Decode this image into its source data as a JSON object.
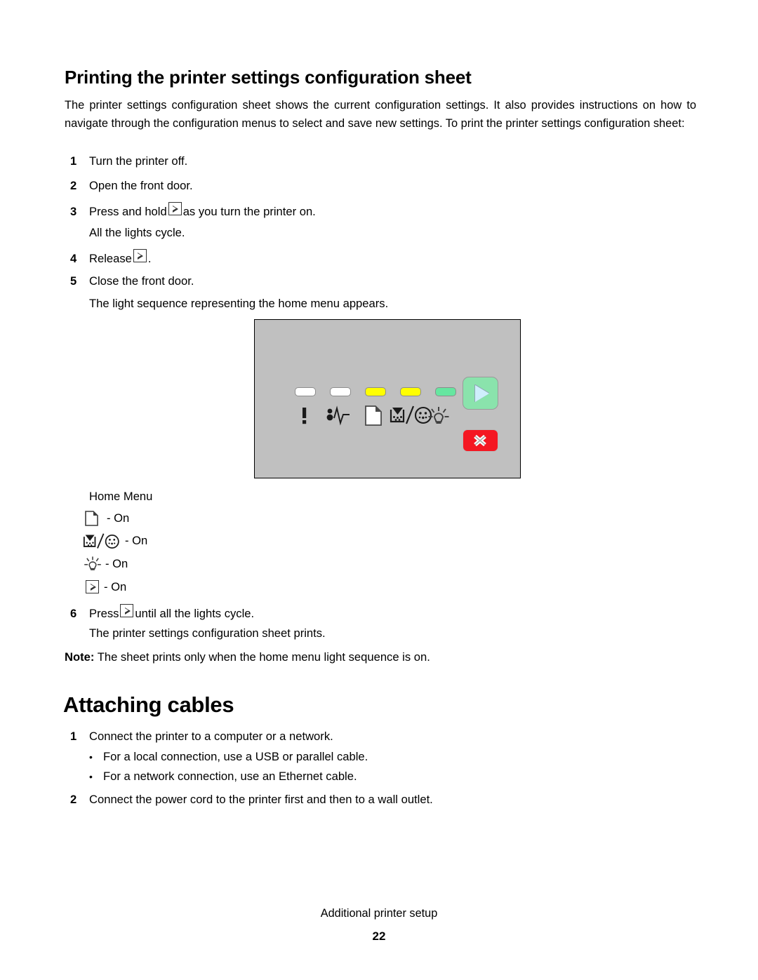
{
  "document": {
    "section1_heading": "Printing the printer settings configuration sheet",
    "intro_paragraph": "The printer settings configuration sheet shows the current configuration settings. It also provides instructions on how to navigate through the configuration menus to select and save new settings. To print the printer settings configuration sheet:",
    "steps": [
      {
        "num": "1",
        "text_before": "Turn the printer off.",
        "text_after": ""
      },
      {
        "num": "2",
        "text_before": "Open the front door.",
        "text_after": ""
      },
      {
        "num": "3",
        "text_before": "Press and hold",
        "text_after": "as you turn the printer on."
      },
      {
        "num": "4",
        "text_before": "Release",
        "text_after": "."
      },
      {
        "num": "5",
        "text_before": "Close the front door.",
        "text_after": ""
      },
      {
        "num": "6",
        "text_before": "Press",
        "text_after": "until all the lights cycle."
      }
    ],
    "step3_result": "All the lights cycle.",
    "step5_result": "The light sequence representing the home menu appears.",
    "step6_result": "The printer settings configuration sheet prints.",
    "note_label": "Note:",
    "note_text": "The sheet prints only when the home menu light sequence is on.",
    "section2_heading": "Attaching cables",
    "cable_steps": [
      {
        "num": "1",
        "text": "Connect the printer to a computer or a network."
      },
      {
        "num": "2",
        "text": "Connect the power cord to the printer first and then to a wall outlet."
      }
    ],
    "cable_bullets": [
      "For a local connection, use a USB or parallel cable.",
      "For a network connection, use an Ethernet cable."
    ]
  },
  "control_panel": {
    "background_color": "#c0c0c0",
    "leds": [
      {
        "name": "error-led",
        "icon": "exclamation-icon",
        "color": "#ffffff",
        "state": "off"
      },
      {
        "name": "paper-jam-led",
        "icon": "paper-jam-icon",
        "color": "#ffffff",
        "state": "off"
      },
      {
        "name": "load-paper-led",
        "icon": "paper-icon",
        "color": "#ffff00",
        "state": "on"
      },
      {
        "name": "toner-led",
        "icon": "toner-cartridge-icon",
        "color": "#ffff00",
        "state": "on"
      },
      {
        "name": "ready-led",
        "icon": "lightbulb-icon",
        "color": "#66e6a0",
        "state": "on"
      }
    ],
    "buttons": [
      {
        "name": "continue-button",
        "icon": "play-triangle-icon",
        "color": "#8ae3ac"
      },
      {
        "name": "cancel-button",
        "icon": "cross-x-icon",
        "color": "#f41722"
      }
    ]
  },
  "legend": {
    "title": "Home Menu",
    "rows": [
      {
        "icon": "paper-icon",
        "state": "- On"
      },
      {
        "icon": "toner-cartridge-icon",
        "state": "- On"
      },
      {
        "icon": "lightbulb-icon",
        "state": "- On"
      },
      {
        "icon": "continue-key-icon",
        "state": "- On"
      }
    ]
  },
  "footer": {
    "chapter": "Additional printer setup",
    "page_number": "22"
  }
}
